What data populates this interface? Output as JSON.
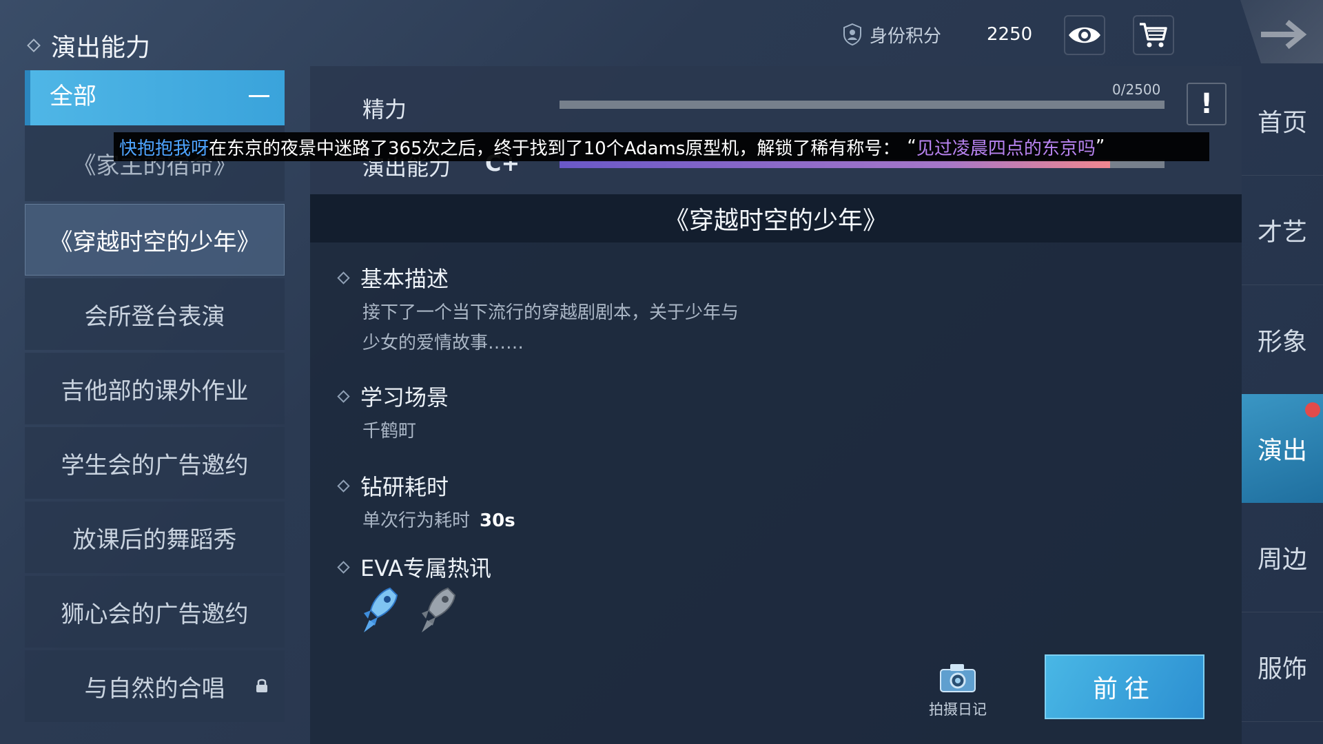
{
  "header": {
    "title": "演出能力",
    "currency_label": "身份积分",
    "currency_value": "2250",
    "icons": [
      "shield-icon",
      "eye-icon",
      "cart-icon",
      "arrow-right-icon"
    ]
  },
  "sidebar": {
    "all_label": "全部",
    "items": [
      {
        "label": "《家主的宿命》"
      },
      {
        "label": "《穿越时空的少年》",
        "active": true
      },
      {
        "label": "会所登台表演"
      },
      {
        "label": "吉他部的课外作业"
      },
      {
        "label": "学生会的广告邀约"
      },
      {
        "label": "放课后的舞蹈秀"
      },
      {
        "label": "狮心会的广告邀约"
      },
      {
        "label": "与自然的合唱",
        "locked": true
      }
    ]
  },
  "stats": {
    "energy_label": "精力",
    "energy_counter": "0/2500",
    "energy_fill": 0.0,
    "performance_label": "演出能力",
    "performance_grade": "C+",
    "performance_fill": 0.91,
    "alert_glyph": "!"
  },
  "detail": {
    "banner_title": "《穿越时空的少年》",
    "sections": {
      "desc_head": "基本描述",
      "desc_line1": "接下了一个当下流行的穿越剧剧本，关于少年与",
      "desc_line2": "少女的爱情故事……",
      "scene_head": "学习场景",
      "scene_value": "千鹤町",
      "time_head": "钻研耗时",
      "time_label": "单次行为耗时",
      "time_value": "30s",
      "eva_head": "EVA专属热讯"
    },
    "rockets": [
      {
        "state": "active"
      },
      {
        "state": "inactive"
      }
    ],
    "diary_label": "拍摄日记",
    "go_label": "前往"
  },
  "right_nav": {
    "items": [
      "首页",
      "才艺",
      "形象",
      "演出",
      "周边",
      "服饰"
    ],
    "active": "演出"
  },
  "toast": {
    "player": "快抱抱我呀",
    "text": "在东京的夜景中迷路了365次之后，终于找到了10个Adams原型机，解锁了稀有称号：",
    "quote_open": "“",
    "title": "见过凌晨四点的东京吗",
    "quote_close": "”"
  },
  "colors": {
    "accent_blue": "#3aa3db",
    "player_name": "#4ea4ff",
    "title_purple": "#b883f0",
    "bar_gradient_end": "#f0878f",
    "notification_red": "#e24b4b"
  }
}
